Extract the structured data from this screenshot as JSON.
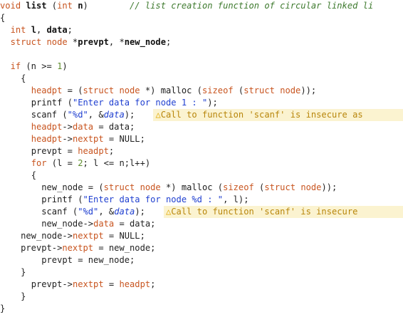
{
  "code_lines": [
    {
      "indent": 0,
      "parts": [
        [
          "kw",
          "void"
        ],
        [
          "pun",
          " "
        ],
        [
          "bold",
          "list"
        ],
        [
          "pun",
          " ("
        ],
        [
          "kw",
          "int"
        ],
        [
          "pun",
          " "
        ],
        [
          "bold",
          "n"
        ],
        [
          "pun",
          ")"
        ],
        [
          "pun",
          "        "
        ],
        [
          "cmt",
          "// list creation function of circular linked li"
        ]
      ]
    },
    {
      "indent": 0,
      "parts": [
        [
          "pun",
          "{"
        ]
      ]
    },
    {
      "indent": 2,
      "parts": [
        [
          "kw",
          "int"
        ],
        [
          "pun",
          " "
        ],
        [
          "bold",
          "l"
        ],
        [
          "pun",
          ", "
        ],
        [
          "bold",
          "data"
        ],
        [
          "pun",
          ";"
        ]
      ]
    },
    {
      "indent": 2,
      "parts": [
        [
          "kw",
          "struct"
        ],
        [
          "pun",
          " "
        ],
        [
          "kw",
          "node"
        ],
        [
          "pun",
          " *"
        ],
        [
          "bold",
          "prevpt"
        ],
        [
          "pun",
          ", *"
        ],
        [
          "bold",
          "new_node"
        ],
        [
          "pun",
          ";"
        ]
      ]
    },
    {
      "indent": 0,
      "parts": [
        [
          "pun",
          ""
        ]
      ]
    },
    {
      "indent": 2,
      "parts": [
        [
          "kw",
          "if"
        ],
        [
          "pun",
          " (n >= "
        ],
        [
          "num",
          "1"
        ],
        [
          "pun",
          ")"
        ]
      ]
    },
    {
      "indent": 4,
      "parts": [
        [
          "pun",
          "{"
        ]
      ]
    },
    {
      "indent": 6,
      "parts": [
        [
          "orng",
          "headpt"
        ],
        [
          "pun",
          " = ("
        ],
        [
          "kw",
          "struct"
        ],
        [
          "pun",
          " "
        ],
        [
          "kw",
          "node"
        ],
        [
          "pun",
          " *) "
        ],
        [
          "fn",
          "malloc"
        ],
        [
          "pun",
          " ("
        ],
        [
          "kw",
          "sizeof"
        ],
        [
          "pun",
          " ("
        ],
        [
          "kw",
          "struct"
        ],
        [
          "pun",
          " "
        ],
        [
          "kw",
          "node"
        ],
        [
          "pun",
          "));"
        ]
      ]
    },
    {
      "indent": 6,
      "parts": [
        [
          "fn",
          "printf"
        ],
        [
          "pun",
          " ("
        ],
        [
          "str",
          "\"Enter data for node 1 : \""
        ],
        [
          "pun",
          ");"
        ]
      ]
    },
    {
      "indent": 6,
      "warning": "Call to function 'scanf' is insecure as",
      "parts": [
        [
          "fn",
          "scanf"
        ],
        [
          "pun",
          " ("
        ],
        [
          "str",
          "\"%d\""
        ],
        [
          "pun",
          ", &"
        ],
        [
          "arg",
          "data"
        ],
        [
          "pun",
          ");"
        ]
      ]
    },
    {
      "indent": 6,
      "parts": [
        [
          "orng",
          "headpt"
        ],
        [
          "pun",
          "->"
        ],
        [
          "orng",
          "data"
        ],
        [
          "pun",
          " = data;"
        ]
      ]
    },
    {
      "indent": 6,
      "parts": [
        [
          "orng",
          "headpt"
        ],
        [
          "pun",
          "->"
        ],
        [
          "orng",
          "nextpt"
        ],
        [
          "pun",
          " = NULL;"
        ]
      ]
    },
    {
      "indent": 6,
      "parts": [
        [
          "pun",
          "prevpt = "
        ],
        [
          "orng",
          "headpt"
        ],
        [
          "pun",
          ";"
        ]
      ]
    },
    {
      "indent": 6,
      "parts": [
        [
          "kw",
          "for"
        ],
        [
          "pun",
          " (l = "
        ],
        [
          "num",
          "2"
        ],
        [
          "pun",
          "; l <= n;l++)"
        ]
      ]
    },
    {
      "indent": 6,
      "parts": [
        [
          "pun",
          "{"
        ]
      ]
    },
    {
      "indent": 8,
      "parts": [
        [
          "pun",
          "new_node = ("
        ],
        [
          "kw",
          "struct"
        ],
        [
          "pun",
          " "
        ],
        [
          "kw",
          "node"
        ],
        [
          "pun",
          " *) "
        ],
        [
          "fn",
          "malloc"
        ],
        [
          "pun",
          " ("
        ],
        [
          "kw",
          "sizeof"
        ],
        [
          "pun",
          " ("
        ],
        [
          "kw",
          "struct"
        ],
        [
          "pun",
          " "
        ],
        [
          "kw",
          "node"
        ],
        [
          "pun",
          "));"
        ]
      ]
    },
    {
      "indent": 8,
      "parts": [
        [
          "fn",
          "printf"
        ],
        [
          "pun",
          " ("
        ],
        [
          "str",
          "\"Enter data for node %d : \""
        ],
        [
          "pun",
          ", l);"
        ]
      ]
    },
    {
      "indent": 8,
      "warning": "Call to function 'scanf' is insecure",
      "parts": [
        [
          "fn",
          "scanf"
        ],
        [
          "pun",
          " ("
        ],
        [
          "str",
          "\"%d\""
        ],
        [
          "pun",
          ", &"
        ],
        [
          "arg",
          "data"
        ],
        [
          "pun",
          ");"
        ]
      ]
    },
    {
      "indent": 8,
      "parts": [
        [
          "pun",
          "new_node->"
        ],
        [
          "orng",
          "data"
        ],
        [
          "pun",
          " = data;"
        ]
      ]
    },
    {
      "indent": 4,
      "parts": [
        [
          "pun",
          "new_node->"
        ],
        [
          "orng",
          "nextpt"
        ],
        [
          "pun",
          " = NULL;"
        ]
      ]
    },
    {
      "indent": 4,
      "parts": [
        [
          "pun",
          "prevpt->"
        ],
        [
          "orng",
          "nextpt"
        ],
        [
          "pun",
          " = new_node;"
        ]
      ]
    },
    {
      "indent": 8,
      "parts": [
        [
          "pun",
          "prevpt = new_node;"
        ]
      ]
    },
    {
      "indent": 4,
      "parts": [
        [
          "pun",
          "}"
        ]
      ]
    },
    {
      "indent": 6,
      "parts": [
        [
          "pun",
          "prevpt->"
        ],
        [
          "orng",
          "nextpt"
        ],
        [
          "pun",
          " = "
        ],
        [
          "orng",
          "headpt"
        ],
        [
          "pun",
          ";"
        ]
      ]
    },
    {
      "indent": 4,
      "parts": [
        [
          "pun",
          "}"
        ]
      ]
    },
    {
      "indent": 0,
      "parts": [
        [
          "pun",
          "}"
        ]
      ]
    }
  ],
  "warning_icon": "warning-triangle-icon",
  "colors": {
    "keyword": "#c8541f",
    "string": "#1f3fd0",
    "comment": "#3e7a2e",
    "number": "#5e8c2c",
    "warning_bg": "#fbf3d0",
    "warning_text": "#b8860b"
  }
}
